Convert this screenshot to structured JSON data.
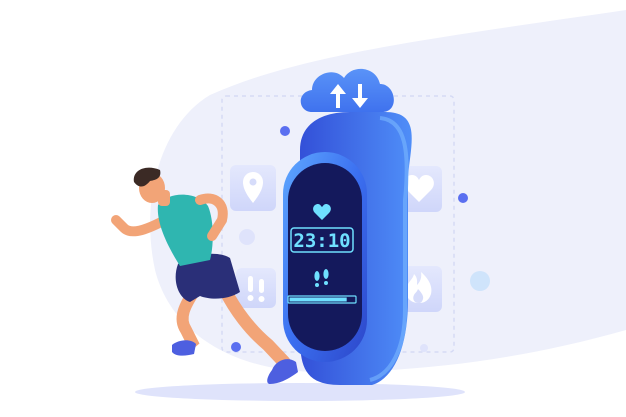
{
  "band": {
    "time": "23:10",
    "progress": 0.88
  },
  "palette": {
    "background_shape": "#eef0fb",
    "band_dark": "#2c46c9",
    "band_mid": "#3b6ff0",
    "band_light": "#5fa8ff",
    "screen": "#14195c",
    "screen_accent": "#6fe0ff",
    "icon_tile": "#dde2fb",
    "icon_glyph": "#ffffff",
    "cloud": "#4a86f7",
    "runner_shirt": "#2fb6b0",
    "runner_shorts": "#2a2f78",
    "runner_shoes": "#4d5fe0",
    "runner_skin": "#f2a477",
    "runner_hair": "#3b2a25"
  },
  "icons": [
    "sync-cloud-icon",
    "location-pin-icon",
    "heart-icon",
    "footsteps-icon",
    "fire-icon"
  ]
}
